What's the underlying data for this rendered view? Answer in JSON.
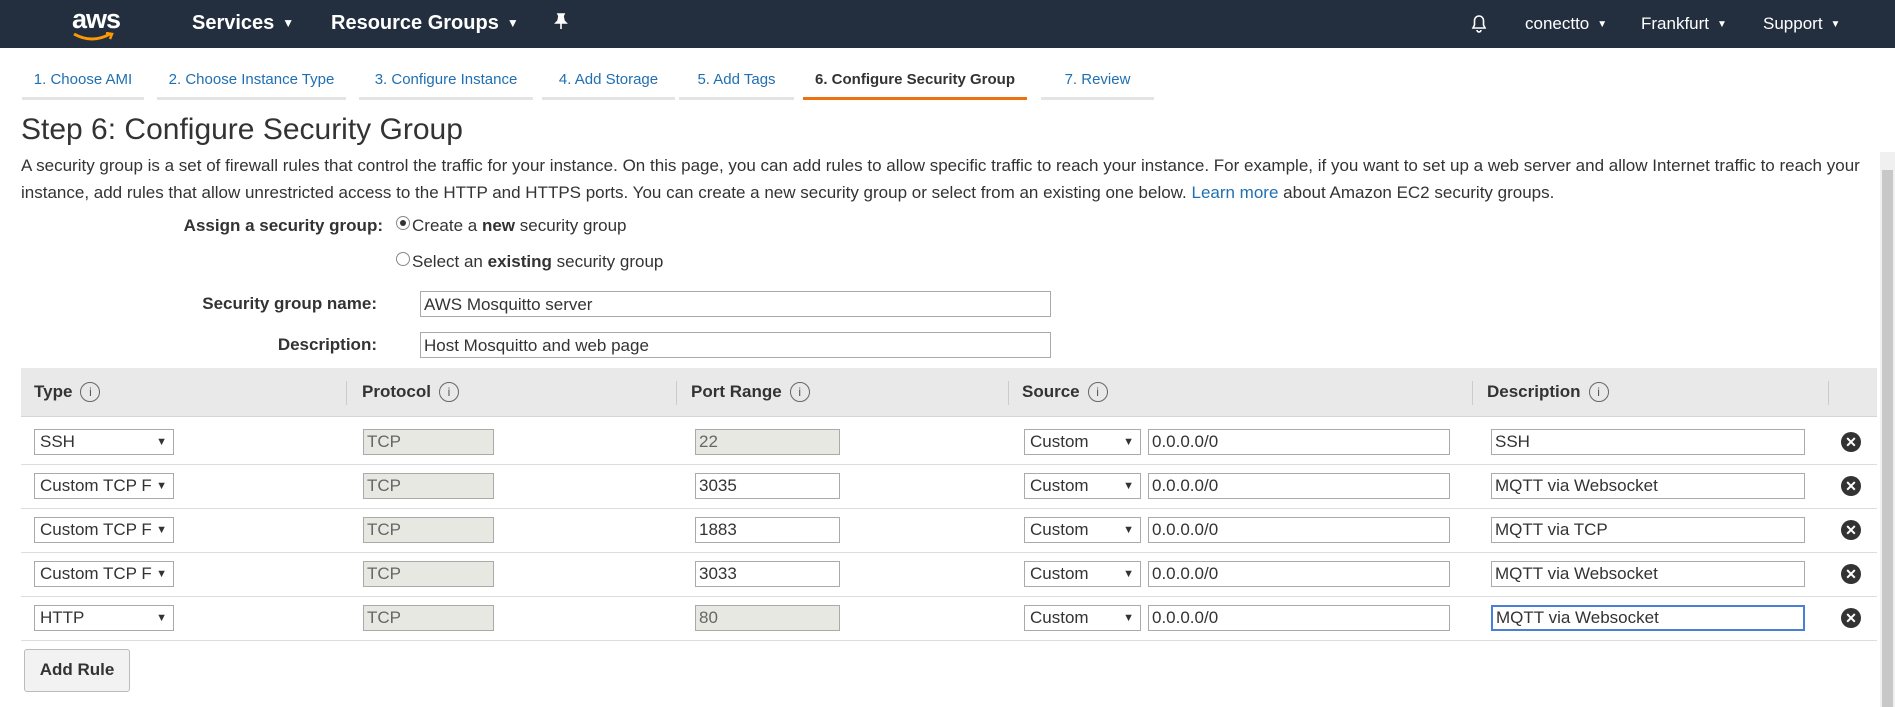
{
  "header": {
    "logo_text": "aws",
    "services_label": "Services",
    "resource_groups_label": "Resource Groups",
    "account_label": "conectto",
    "region_label": "Frankfurt",
    "support_label": "Support",
    "bg_color": "#232f3e"
  },
  "wizard_tabs": [
    {
      "label": "1. Choose AMI"
    },
    {
      "label": "2. Choose Instance Type"
    },
    {
      "label": "3. Configure Instance"
    },
    {
      "label": "4. Add Storage"
    },
    {
      "label": "5. Add Tags"
    },
    {
      "label": "6. Configure Security Group",
      "active": true
    },
    {
      "label": "7. Review"
    }
  ],
  "page": {
    "title": "Step 6: Configure Security Group",
    "intro_text": "A security group is a set of firewall rules that control the traffic for your instance. On this page, you can add rules to allow specific traffic to reach your instance. For example, if you want to set up a web server and allow Internet traffic to reach your instance, add rules that allow unrestricted access to the HTTP and HTTPS ports. You can create a new security group or select from an existing one below.",
    "learn_more_label": "Learn more",
    "intro_suffix": "about Amazon EC2 security groups."
  },
  "form": {
    "assign_label": "Assign a security group:",
    "option_create_pre": "Create a",
    "option_create_bold": "new",
    "option_create_post": "security group",
    "option_select_pre": "Select an",
    "option_select_bold": "existing",
    "option_select_post": "security group",
    "name_label": "Security group name:",
    "name_value": "AWS Mosquitto server",
    "description_label": "Description:",
    "description_value": "Host Mosquitto and web page"
  },
  "table": {
    "columns": [
      "Type",
      "Protocol",
      "Port Range",
      "Source",
      "Description"
    ],
    "info_icon_char": "i",
    "rows": [
      {
        "type": "SSH",
        "protocol": "TCP",
        "port": "22",
        "source_type": "Custom",
        "source": "0.0.0.0/0",
        "description": "SSH"
      },
      {
        "type": "Custom TCP F",
        "protocol": "TCP",
        "port": "3035",
        "source_type": "Custom",
        "source": "0.0.0.0/0",
        "description": "MQTT via Websocket"
      },
      {
        "type": "Custom TCP F",
        "protocol": "TCP",
        "port": "1883",
        "source_type": "Custom",
        "source": "0.0.0.0/0",
        "description": "MQTT via TCP"
      },
      {
        "type": "Custom TCP F",
        "protocol": "TCP",
        "port": "3033",
        "source_type": "Custom",
        "source": "0.0.0.0/0",
        "description": "MQTT via Websocket"
      },
      {
        "type": "HTTP",
        "protocol": "TCP",
        "port": "80",
        "source_type": "Custom",
        "source": "0.0.0.0/0",
        "description": "MQTT via Websocket"
      }
    ],
    "remove_icon_char": "✕",
    "add_rule_label": "Add Rule"
  },
  "colors": {
    "link": "#1f6fb2",
    "active_tab_underline": "#ec7211"
  }
}
